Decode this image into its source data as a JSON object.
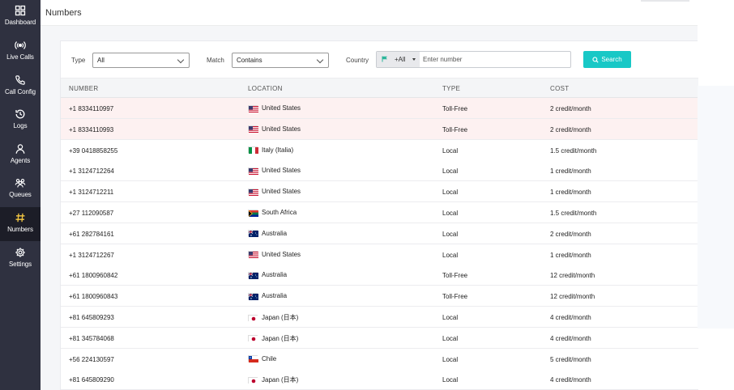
{
  "sidebar": {
    "items": [
      {
        "label": "Dashboard",
        "icon": "grid-icon"
      },
      {
        "label": "Live Calls",
        "icon": "broadcast-icon"
      },
      {
        "label": "Call Config",
        "icon": "phone-icon"
      },
      {
        "label": "Logs",
        "icon": "history-icon"
      },
      {
        "label": "Agents",
        "icon": "user-icon"
      },
      {
        "label": "Queues",
        "icon": "users-icon"
      },
      {
        "label": "Numbers",
        "icon": "hash-icon",
        "active": true
      },
      {
        "label": "Settings",
        "icon": "gear-icon"
      }
    ]
  },
  "header": {
    "title": "Numbers"
  },
  "filters": {
    "type_label": "Type",
    "type_value": "All",
    "match_label": "Match",
    "match_value": "Contains",
    "country_label": "Country",
    "country_value": "+All",
    "number_placeholder": "Enter number",
    "search_label": "Search"
  },
  "table": {
    "headers": {
      "number": "NUMBER",
      "location": "LOCATION",
      "type": "TYPE",
      "cost": "COST"
    },
    "rows": [
      {
        "number": "+1 8334110997",
        "flag": "us",
        "location": "United States",
        "type": "Toll-Free",
        "cost": "2 credit/month",
        "highlight": true
      },
      {
        "number": "+1 8334110993",
        "flag": "us",
        "location": "United States",
        "type": "Toll-Free",
        "cost": "2 credit/month",
        "highlight": true
      },
      {
        "number": "+39 0418858255",
        "flag": "it",
        "location": "Italy (Italia)",
        "type": "Local",
        "cost": "1.5 credit/month"
      },
      {
        "number": "+1 3124712264",
        "flag": "us",
        "location": "United States",
        "type": "Local",
        "cost": "1 credit/month"
      },
      {
        "number": "+1 3124712211",
        "flag": "us",
        "location": "United States",
        "type": "Local",
        "cost": "1 credit/month"
      },
      {
        "number": "+27 112090587",
        "flag": "za",
        "location": "South Africa",
        "type": "Local",
        "cost": "1.5 credit/month"
      },
      {
        "number": "+61 282784161",
        "flag": "au",
        "location": "Australia",
        "type": "Local",
        "cost": "2 credit/month"
      },
      {
        "number": "+1 3124712267",
        "flag": "us",
        "location": "United States",
        "type": "Local",
        "cost": "1 credit/month"
      },
      {
        "number": "+61 1800960842",
        "flag": "au",
        "location": "Australia",
        "type": "Toll-Free",
        "cost": "12 credit/month"
      },
      {
        "number": "+61 1800960843",
        "flag": "au",
        "location": "Australia",
        "type": "Toll-Free",
        "cost": "12 credit/month"
      },
      {
        "number": "+81 645809293",
        "flag": "jp",
        "location": "Japan (日本)",
        "type": "Local",
        "cost": "4 credit/month"
      },
      {
        "number": "+81 345784068",
        "flag": "jp",
        "location": "Japan (日本)",
        "type": "Local",
        "cost": "4 credit/month"
      },
      {
        "number": "+56 224130597",
        "flag": "cl",
        "location": "Chile",
        "type": "Local",
        "cost": "5 credit/month"
      },
      {
        "number": "+81 645809290",
        "flag": "jp",
        "location": "Japan (日本)",
        "type": "Local",
        "cost": "4 credit/month"
      }
    ]
  },
  "colors": {
    "sidebar": "#2f3140",
    "sidebar_active": "#1c1d27",
    "accent": "#18c8c6",
    "highlight_row": "#fdf1f1"
  }
}
